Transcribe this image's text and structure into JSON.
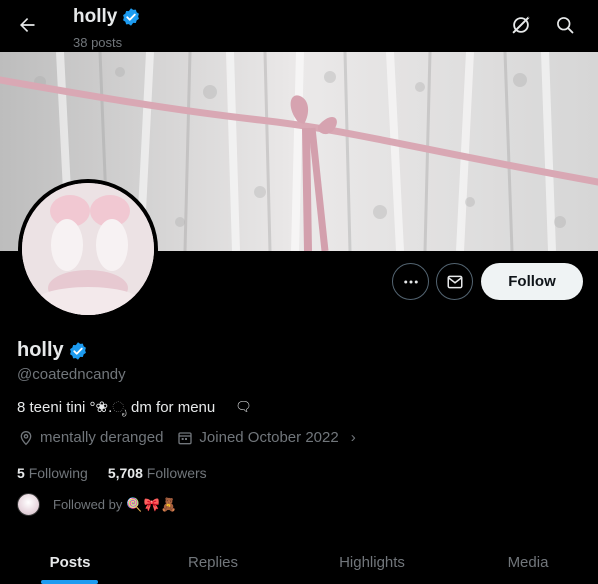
{
  "header": {
    "name": "holly",
    "posts_count": "38 posts",
    "icons": {
      "back": "arrow-left-icon",
      "grok": "grok-icon",
      "search": "search-icon"
    }
  },
  "profile": {
    "name": "holly",
    "verified": true,
    "handle": "@coatedncandy",
    "bio": "8 teeni tini °❀.ೃ dm for menu",
    "bio_emoji": "🗨",
    "location": "mentally deranged",
    "joined": "Joined October 2022",
    "following_count": "5",
    "following_label": "Following",
    "followers_count": "5,708",
    "followers_label": "Followers",
    "followed_by_label": "Followed by",
    "followed_by_names": "🍭🎀🧸"
  },
  "actions": {
    "more_icon": "more-horizontal-icon",
    "message_icon": "mail-icon",
    "follow_label": "Follow"
  },
  "tabs": [
    {
      "label": "Posts",
      "active": true
    },
    {
      "label": "Replies",
      "active": false
    },
    {
      "label": "Highlights",
      "active": false
    },
    {
      "label": "Media",
      "active": false
    }
  ],
  "colors": {
    "accent": "#1d9bf0",
    "background": "#000000",
    "text_primary": "#e7e9ea",
    "text_secondary": "#71767b",
    "verified": "#1d9bf0"
  }
}
